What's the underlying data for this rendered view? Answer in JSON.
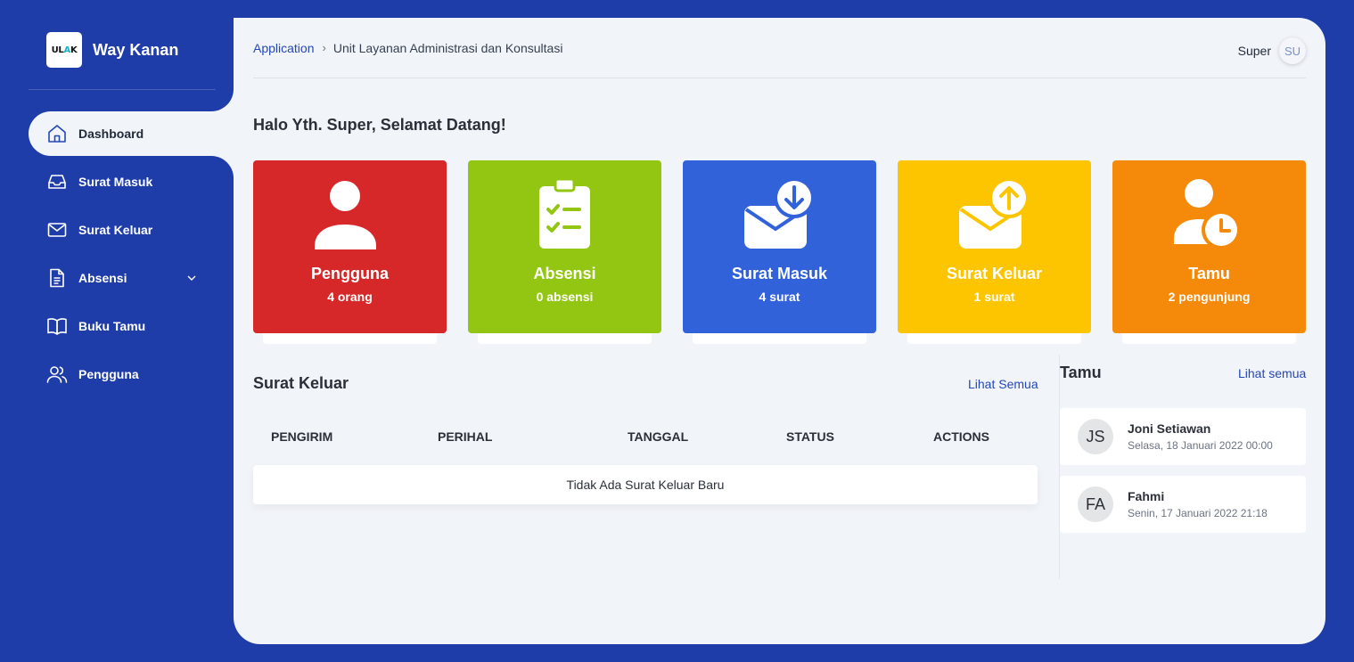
{
  "brand": {
    "logo_text_a": "UL",
    "logo_text_b": "A",
    "logo_text_c": "K",
    "name": "Way Kanan"
  },
  "sidebar": {
    "items": [
      {
        "label": "Dashboard",
        "icon": "home-icon",
        "active": true
      },
      {
        "label": "Surat Masuk",
        "icon": "inbox-icon"
      },
      {
        "label": "Surat Keluar",
        "icon": "mail-icon"
      },
      {
        "label": "Absensi",
        "icon": "document-icon",
        "has_submenu": true
      },
      {
        "label": "Buku Tamu",
        "icon": "book-open-icon"
      },
      {
        "label": "Pengguna",
        "icon": "users-icon"
      }
    ]
  },
  "breadcrumb": {
    "root": "Application",
    "separator": "›",
    "current": "Unit Layanan Administrasi dan Konsultasi"
  },
  "user": {
    "name": "Super",
    "initials": "SU"
  },
  "greeting": "Halo Yth. Super, Selamat Datang!",
  "cards": [
    {
      "title": "Pengguna",
      "subtitle": "4 orang",
      "color": "#d62828",
      "icon": "user-icon"
    },
    {
      "title": "Absensi",
      "subtitle": "0 absensi",
      "color": "#93c613",
      "icon": "clipboard-check-icon"
    },
    {
      "title": "Surat Masuk",
      "subtitle": "4 surat",
      "color": "#3262d9",
      "icon": "mail-download-icon"
    },
    {
      "title": "Surat Keluar",
      "subtitle": "1 surat",
      "color": "#fcc500",
      "icon": "mail-upload-icon"
    },
    {
      "title": "Tamu",
      "subtitle": "2 pengunjung",
      "color": "#f5890a",
      "icon": "user-clock-icon"
    }
  ],
  "surat_keluar": {
    "title": "Surat Keluar",
    "link": "Lihat Semua",
    "columns": [
      "PENGIRIM",
      "PERIHAL",
      "TANGGAL",
      "STATUS",
      "ACTIONS"
    ],
    "empty_message": "Tidak Ada Surat Keluar Baru"
  },
  "tamu": {
    "title": "Tamu",
    "link": "Lihat semua",
    "items": [
      {
        "initials": "JS",
        "name": "Joni Setiawan",
        "date": "Selasa, 18 Januari 2022 00:00"
      },
      {
        "initials": "FA",
        "name": "Fahmi",
        "date": "Senin, 17 Januari 2022 21:18"
      }
    ]
  },
  "colors": {
    "primary": "#1f3da9",
    "background": "#f1f4f8",
    "link": "#2447b8"
  }
}
